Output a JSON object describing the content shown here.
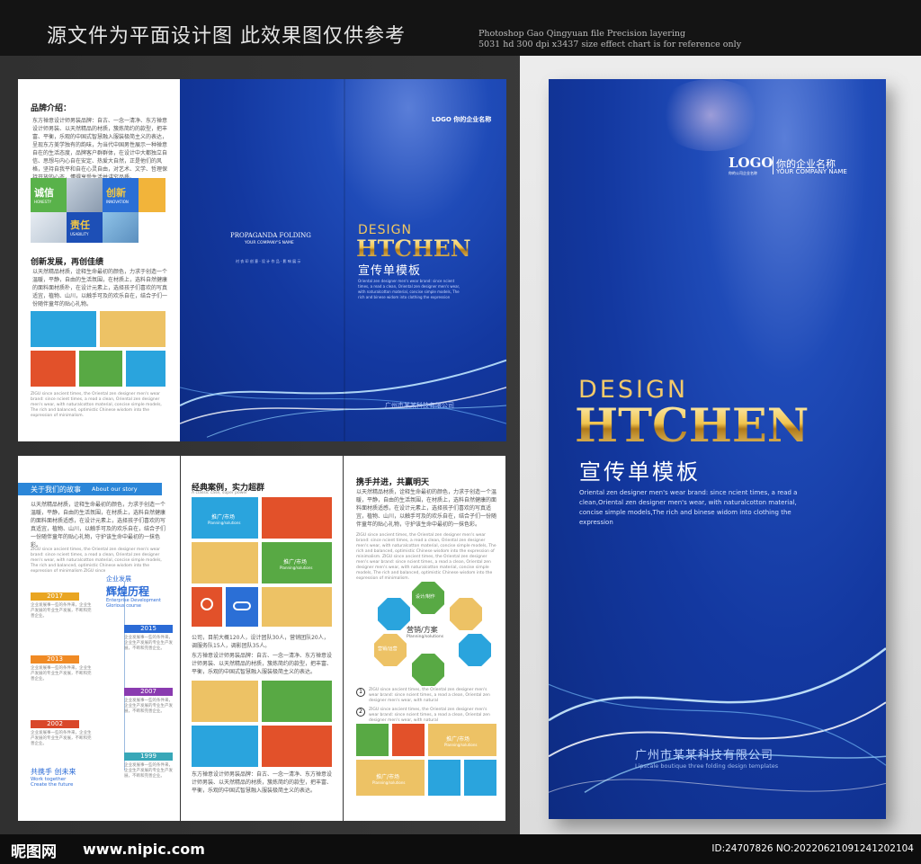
{
  "banner": {
    "cn": "源文件为平面设计图  此效果图仅供参考",
    "en_line1": "Photoshop Gao Qingyuan file Precision layering",
    "en_line2": "5031 hd 300 dpi x3437 size effect chart is for reference only"
  },
  "footer": {
    "site_logo": "昵图网",
    "url": "www.nipic.com",
    "image_id": "ID:24707826 NO:20220621091241202104"
  },
  "outer_left": {
    "brand_title": "品牌介绍：",
    "brand_text": "东方禅意设计师男装品牌：自古、一念一清净、东方禅意设计师男装、以天然精品的材质，簇炼简约的款型，把丰富、平衡，乐观的中国式智慧融入服装极简主义的表达，呈现东方美学独有的韵味，为当代中国男性展示一种禅意自在的生活态度，品牌客户群群体，在设计中大都独立自信、思想与内心自在安定、热爱大自然，正是他们的风格，坚持自我平和自在心灵自由，对艺术、文学、哲理保持开放的心态，懂得享受生活并讲究品质。",
    "tiles": [
      "诚信",
      "创新",
      "责任"
    ],
    "tile_en": [
      "HONESTY",
      "INNOVATION",
      "USABILITY"
    ],
    "innov_title": "创新发展，再创佳绩",
    "innov_text": "以天然精品材质，诠释生命最初的颜色，力求于创造一个温暖，平静，自由的生活氛围，在材质上，选料自然健康的面料面材质朴，在设计元素上，选择孩子们喜欢的写真适宜，植物、山川，以触手可及的欢乐自在，结合子们一份随伴童年的贴心礼物。",
    "foot_text": "ZIGU since ancient times, the Oriental zen designer men's wear brand: since ncient times, a read a clean, Oriental zen designer men's wear, with naturalcotton material, concise simple models, The rich and balanced, optimistic Chinese wisdom into the expression of minimalism."
  },
  "back_cover": {
    "title": "PROPAGANDA FOLDING",
    "sub": "YOUR COMPANY'S NAME",
    "note": "衬 衣 印 创 意 · 设 计 作 品 · 影 响 展 示"
  },
  "front_cover_small": {
    "logo": "LOGO",
    "company": "你的企业名称",
    "design": "DESIGN",
    "brand": "HTCHEN",
    "subtitle": "宣传单模板",
    "desc": "Oriental zen designer men's wear brand: since ncient times, a read a clean, Oriental zen designer men's wear, with naturalcotton material, concise simple models, The rich and binese widom into clothing the expression",
    "bottom": "广州市某某科技有限公司"
  },
  "inner_left": {
    "story_cn": "关于我们的故事",
    "story_en": "About our story",
    "story_text": "以天然精品材质，诠释生命最初的颜色，力求于创造一个温暖，平静，自由的生活氛围，在材质上，选料自然健康的面料面材质适感，在设计元素上，选择孩子们喜欢的写真适宜，植物、山川，以触手可及的欢乐自在，结合子们一份随伴童年的贴心礼物，守护该生命中最初的一抹色彩。",
    "story_en_text": "ZIGU since ancient times, the Oriental zen designer men's wear brand: since ncient times, a read a clean, Oriental zen designer men's wear, with naturalcotton material, concise simple models, The rich and balanced, optimistic Chinese wisdom into the expression of minimalism ZIGU since",
    "enterprise": "企业发展",
    "glory": "辉煌历程",
    "glory_en1": "Enterprise Development",
    "glory_en2": "Glorious course",
    "years": [
      "2017",
      "2015",
      "2013",
      "2007",
      "2002",
      "1999"
    ],
    "year_text": "企业发展事一些的条件来，企业生产发展的专业生产发展，不断和完善企业。",
    "future_cn": "共携手 创未来",
    "future_en1": "Work together",
    "future_en2": "Create the future"
  },
  "inner_mid": {
    "title": "经典案例，实力超群",
    "sub": "A classic case, super power",
    "tile_a": "推广/市场",
    "tile_a_en": "Planning/solutions",
    "tile_b": "推广/市场",
    "tile_b_en": "Planning/solutions",
    "stats": "公司，目前大概120人，设计团队30人，营销团队20人，调服务队15人，调影团队35人。",
    "text": "东方禅意设计师男装品牌：自古、一念一清净、东方禅意设计师男装、以天然精品的材质，簇炼简约的款型，把丰富、平衡，乐观的中国式智慧融入服装极简主义的表达。",
    "text2": "东方禅意设计师男装品牌：自古、一念一清净、东方禅意设计师男装、以天然精品的材质，簇炼简约的款型，把丰富、平衡，乐观的中国式智慧融入服装极简主义的表达。"
  },
  "inner_right": {
    "title": "携手并进，共赢明天",
    "text": "以天然精品材质，诠释生命最初的颜色，力求于创造一个温暖，平静，自由的生活氛围，在材质上，选料自然健康的面料面材质适感，在设计元素上，选择孩子们喜欢的写真适宜，植物、山川，以触手可及的欢乐自在，结合子们一份随伴童年的贴心礼物，守护该生命中最初的一抹色彩。",
    "en_text": "ZIGU since ancient times, the Oriental zen designer men's wear brand: since ncient times, a read a clean, Oriental zen designer men's wear, with naturalcotton material, concise simple models, The rich and balanced, optimistic Chinese wisdom into the expression of minimalism. ZIGU since ancient times, the Oriental zen designer men's wear brand: since ncient times, a read a clean, Oriental zen designer men's wear, with naturalcotton material, concise simple models, The rich and balanced, optimistic Chinese wisdom into the expression of minimalism.",
    "hub_cn": "营销/方案",
    "hub_en": "Planning/solutions",
    "oct_top": "设计/制作",
    "oct_left": "营销/运营",
    "item1": "ZIGU since ancient times, the Oriental zen designer men's wear brand: since ncient times, a read a clean, Oriental zen designer men's wear, with natural",
    "item2": "ZIGU since ancient times, the Oriental zen designer men's wear brand: since ncient times, a read a clean, Oriental zen designer men's wear, with natural",
    "tile_a": "推广/市场",
    "tile_a_en": "Planning/solutions",
    "tile_b": "推广/市场",
    "tile_b_en": "Planning/solutions"
  },
  "big_cover": {
    "logo": "LOGO",
    "logo_sub": "你的公司企业名称",
    "company": "你的企业名称",
    "company_en": "YOUR COMPANY NAME",
    "design": "DESIGN",
    "brand": "HTCHEN",
    "subtitle": "宣传单模板",
    "desc": "Oriental zen designer men's wear brand: since ncient times, a read a clean,Oriental zen designer men's wear, with naturalcotton material, concise simple models,The rich and binese widom into clothing the expression",
    "bottom_cn": "广州市某某科技有限公司",
    "bottom_en": "Lipscale boutique three folding design templates"
  }
}
